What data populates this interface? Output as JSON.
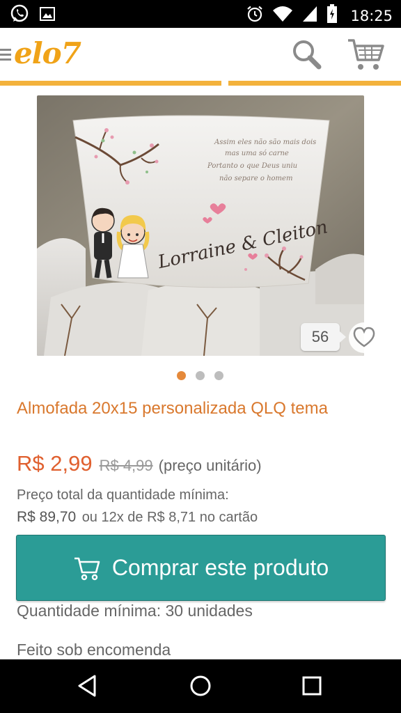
{
  "status_bar": {
    "time": "18:25",
    "icons": [
      "whatsapp-icon",
      "image-icon",
      "alarm-icon",
      "wifi-icon",
      "signal-icon",
      "battery-icon"
    ]
  },
  "header": {
    "logo": "elo7",
    "icons": [
      "menu-icon",
      "search-icon",
      "cart-icon"
    ]
  },
  "product": {
    "image_text": {
      "names": "Lorraine & Cleiton"
    },
    "favorites_count": "56",
    "carousel": {
      "total": 3,
      "active": 1
    },
    "title": "Almofada 20x15 personalizada QLQ tema",
    "price": "R$ 2,99",
    "old_price": "R$ 4,99",
    "price_note": "(preço unitário)",
    "total_label": "Preço total da quantidade mínima:",
    "total_value": "R$ 89,70",
    "installments": "ou 12x de R$ 8,71 no cartão",
    "buy_label": "Comprar este produto",
    "min_quantity": "Quantidade mínima: 30 unidades",
    "made_to_order": "Feito sob encomenda"
  },
  "colors": {
    "brand": "#f0a318",
    "title": "#d9782d",
    "price": "#e0602f",
    "buy_button": "#2b9c96",
    "dot_active": "#e5893a"
  },
  "nav_bar": {
    "icons": [
      "back-icon",
      "home-icon",
      "recents-icon"
    ]
  }
}
